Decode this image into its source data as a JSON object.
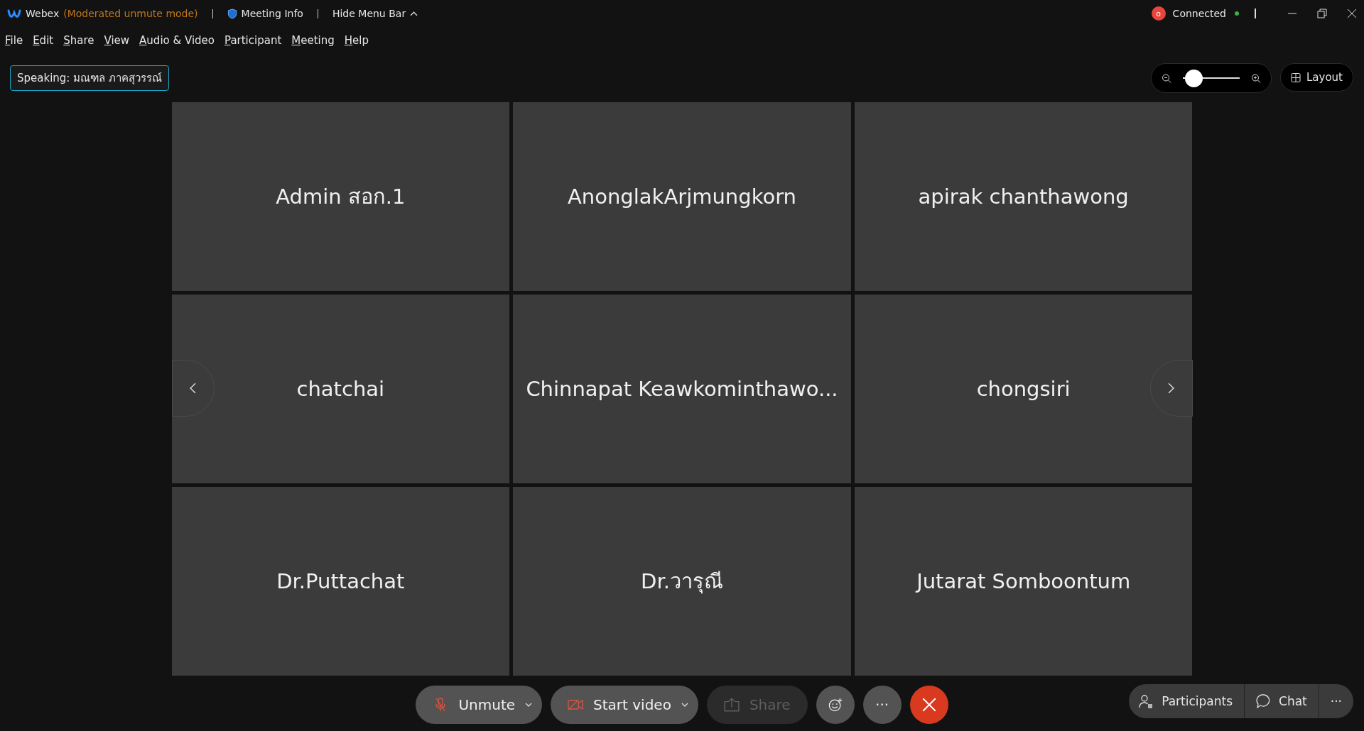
{
  "title_bar": {
    "app_name": "Webex",
    "mode": "(Moderated unmute mode)",
    "meeting_info": "Meeting Info",
    "hide_menu_bar": "Hide Menu Bar",
    "recording_badge": "o",
    "connection": "Connected",
    "connected": true
  },
  "menu": [
    "File",
    "Edit",
    "Share",
    "View",
    "Audio & Video",
    "Participant",
    "Meeting",
    "Help"
  ],
  "speaking": "Speaking: มณฑล ภาคสุวรรณ์",
  "zoom": {
    "level": 0.05
  },
  "layout_button": "Layout",
  "tiles": [
    "Admin สอก.1",
    "AnonglakArjmungkorn",
    "apirak chanthawong",
    "chatchai",
    "Chinnapat Keawkominthawo...",
    "chongsiri",
    "Dr.Puttachat",
    "Dr.วารุณี",
    "Jutarat Somboontum"
  ],
  "controls": [
    {
      "kind": "mute",
      "label": "Unmute"
    },
    {
      "kind": "video",
      "label": "Start video"
    },
    {
      "kind": "share",
      "label": "Share",
      "disabled": true
    },
    {
      "kind": "reactions"
    },
    {
      "kind": "more",
      "label": "···"
    },
    {
      "kind": "leave"
    }
  ],
  "panels": [
    {
      "kind": "participants",
      "label": "Participants"
    },
    {
      "kind": "chat",
      "label": "Chat"
    },
    {
      "kind": "more",
      "label": "···"
    }
  ]
}
